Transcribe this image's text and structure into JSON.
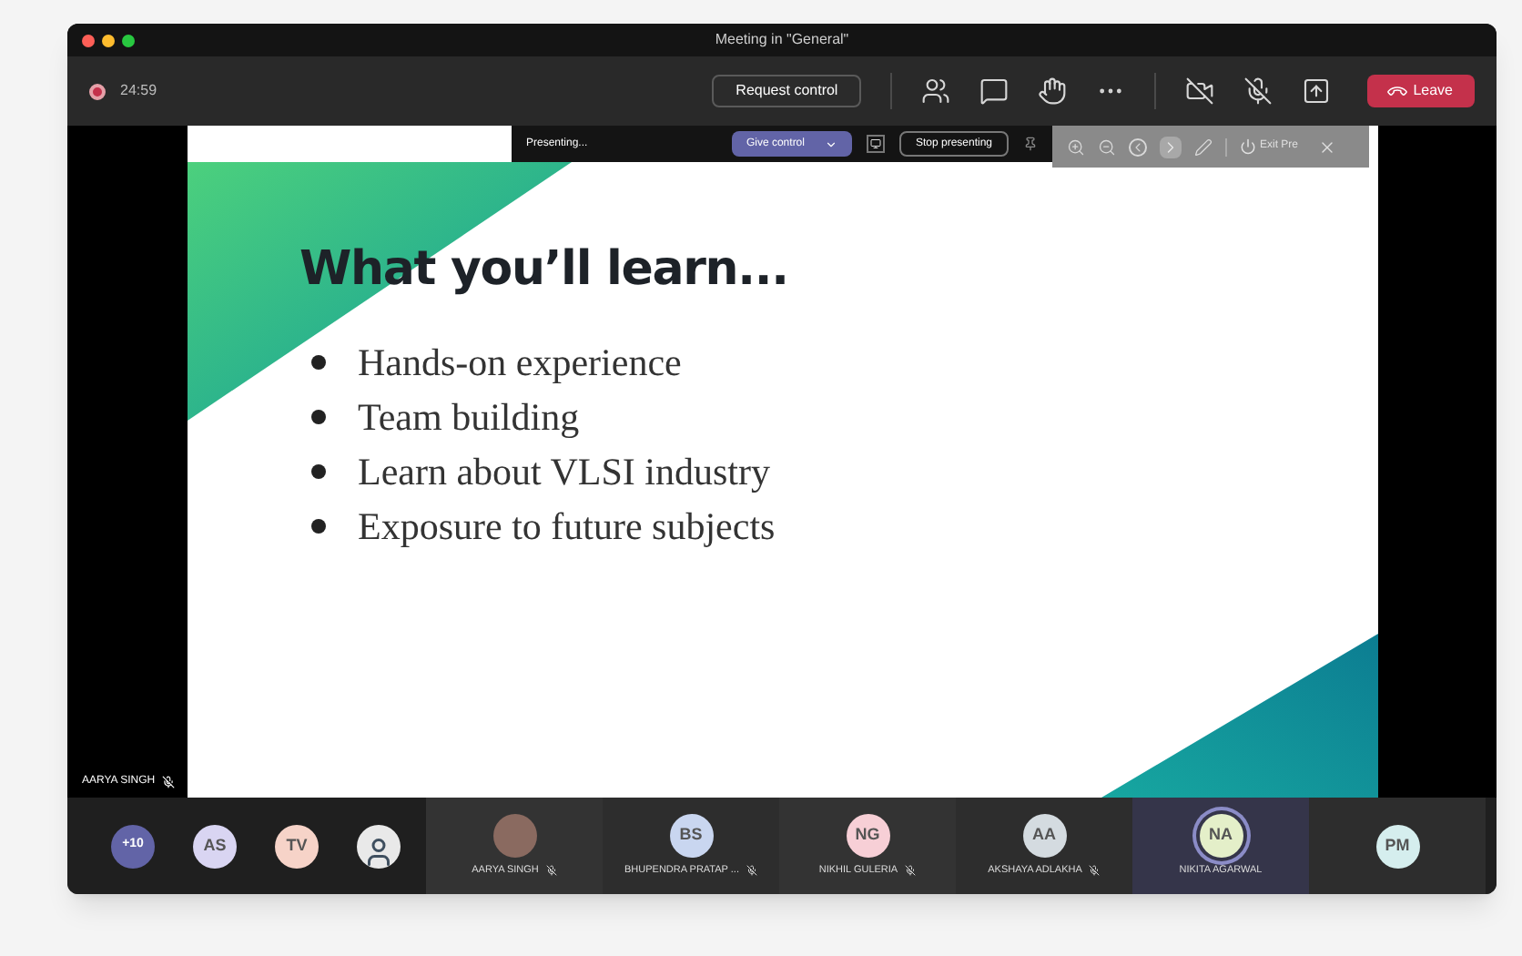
{
  "window": {
    "title": "Meeting in \"General\""
  },
  "toolbar": {
    "recording": true,
    "timer": "24:59",
    "request_control": "Request control",
    "leave": "Leave"
  },
  "presenting_bar": {
    "status": "Presenting...",
    "give_control": "Give control",
    "stop_presenting": "Stop presenting",
    "exit_label": "Exit Pre"
  },
  "slide": {
    "title": "What you’ll learn...",
    "bullets": [
      "Hands-on experience",
      "Team building",
      "Learn about VLSI industry",
      "Exposure to future subjects"
    ]
  },
  "presenter": {
    "name": "AARYA SINGH",
    "muted": true
  },
  "avatars": [
    {
      "kind": "count",
      "text": "+10",
      "color": "#6264a7"
    },
    {
      "kind": "initials",
      "text": "AS",
      "color": "#d9d5f2"
    },
    {
      "kind": "initials",
      "text": "TV",
      "color": "#f6d3c8"
    },
    {
      "kind": "photo"
    }
  ],
  "tiles": [
    {
      "kind": "photo",
      "name": "AARYA SINGH",
      "muted": true,
      "speaking": false
    },
    {
      "kind": "initials",
      "initials": "BS",
      "color": "#c9d6f0",
      "name": "BHUPENDRA PRATAP ...",
      "muted": true,
      "speaking": false
    },
    {
      "kind": "initials",
      "initials": "NG",
      "color": "#f7cfd6",
      "name": "NIKHIL GULERIA",
      "muted": true,
      "speaking": false
    },
    {
      "kind": "initials",
      "initials": "AA",
      "color": "#d4dbe0",
      "name": "AKSHAYA ADLAKHA",
      "muted": true,
      "speaking": false
    },
    {
      "kind": "initials",
      "initials": "NA",
      "color": "#e4efc9",
      "name": "NIKITA AGARWAL",
      "muted": false,
      "speaking": true
    },
    {
      "kind": "initials",
      "initials": "PM",
      "color": "#d5eeee",
      "speaking": false
    }
  ]
}
